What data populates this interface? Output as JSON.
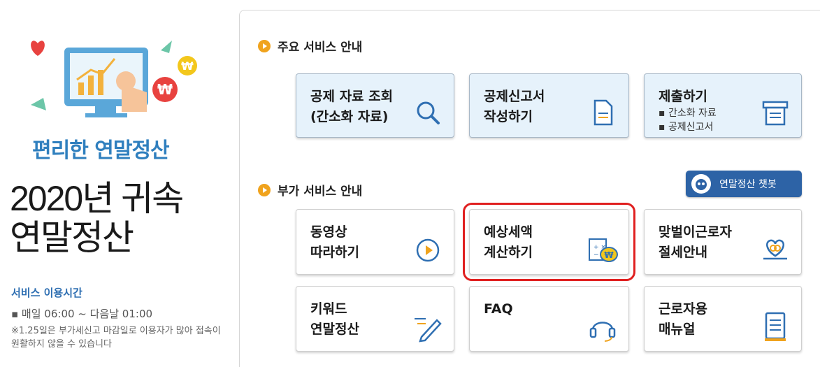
{
  "promo": {
    "subtitle": "편리한 연말정산",
    "title_line1": "2020년 귀속",
    "title_line2": "연말정산",
    "hours_title": "서비스 이용시간",
    "hours_line": "▪ 매일 06:00 ~ 다음날 01:00",
    "note": "※1.25일은 부가세신고 마감일로 이용자가 많아 접속이 원활하지 않을 수 있습니다"
  },
  "main_services": {
    "heading": "주요 서비스 안내",
    "cards": [
      {
        "label": "공제 자료 조회\n(간소화 자료)",
        "icon": "magnifier-icon"
      },
      {
        "label": "공제신고서\n작성하기",
        "icon": "document-icon"
      },
      {
        "label": "제출하기",
        "sub1": "▪ 간소화 자료",
        "sub2": "▪ 공제신고서",
        "icon": "submit-tray-icon"
      }
    ]
  },
  "extra_services": {
    "heading": "부가 서비스 안내",
    "chatbot_label": "연말정산 챗봇",
    "cards": [
      {
        "label": "동영상\n따라하기",
        "icon": "play-icon"
      },
      {
        "label": "예상세액\n계산하기",
        "icon": "calculator-money-icon"
      },
      {
        "label": "맞벌이근로자\n절세안내",
        "icon": "heart-hand-icon"
      },
      {
        "label": "키워드\n연말정산",
        "icon": "pen-icon"
      },
      {
        "label": "FAQ",
        "icon": "headset-icon"
      },
      {
        "label": "근로자용\n매뉴얼",
        "icon": "manual-icon"
      }
    ]
  },
  "colors": {
    "accent": "#2f7fbe",
    "card_blue": "#e6f2fb",
    "bullet": "#f0a31d",
    "highlight": "#e02020"
  }
}
